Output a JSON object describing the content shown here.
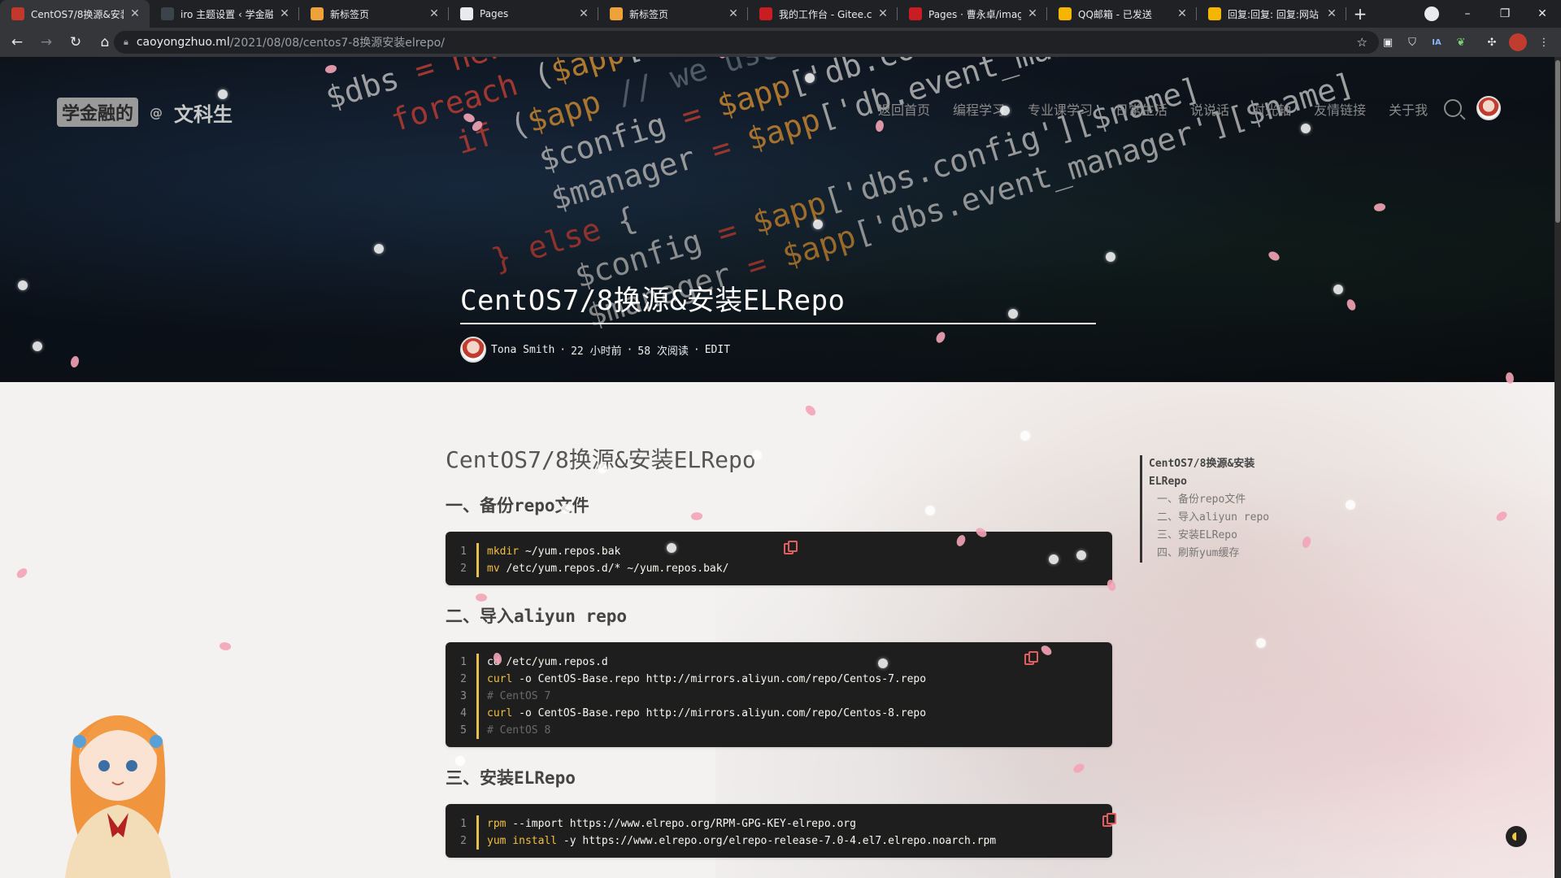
{
  "browser": {
    "tabs": [
      {
        "title": "CentOS7/8换源&安装",
        "icon_color": "#c0392b",
        "icon": "blog-favicon",
        "active": true
      },
      {
        "title": "iro 主题设置 ‹ 学金融",
        "icon_color": "#3c434a",
        "icon": "wordpress-icon"
      },
      {
        "title": "新标签页",
        "icon_color": "#f0a23a",
        "icon": "infinity-icon"
      },
      {
        "title": "Pages",
        "icon_color": "#e8eaed",
        "icon": "github-icon"
      },
      {
        "title": "新标签页",
        "icon_color": "#f0a23a",
        "icon": "infinity-icon"
      },
      {
        "title": "我的工作台 - Gitee.co",
        "icon_color": "#c71d23",
        "icon": "gitee-icon"
      },
      {
        "title": "Pages · 曹永卓/imag",
        "icon_color": "#c71d23",
        "icon": "gitee-icon"
      },
      {
        "title": "QQ邮箱 - 已发送",
        "icon_color": "#f5b500",
        "icon": "qqmail-icon"
      },
      {
        "title": "回复:回复: 回复:网站",
        "icon_color": "#f5b500",
        "icon": "qqmail-icon"
      }
    ],
    "new_tab": "+",
    "window_controls": [
      "–",
      "❐",
      "✕"
    ],
    "url_host": "caoyongzhuo.ml",
    "url_path": "/2021/08/08/centos7-8换源安装elrepo/",
    "ext_badge": "6"
  },
  "site": {
    "logo_box": "学金融的",
    "logo_at": "@",
    "logo_name": "文科生",
    "nav": [
      "返回首页",
      "编程学习",
      "专业课学习",
      "日常生活",
      "说说话",
      "时光轴",
      "友情链接",
      "关于我"
    ]
  },
  "post": {
    "hero_title": "CentOS7/8换源&安装ELRepo",
    "author": "Tona Smith",
    "time": "22 小时前",
    "reads": "58 次阅读",
    "edit": "EDIT",
    "title": "CentOS7/8换源&安装ELRepo",
    "sections": [
      {
        "heading": "一、备份repo文件"
      },
      {
        "heading": "二、导入aliyun repo"
      },
      {
        "heading": "三、安装ELRepo"
      }
    ],
    "code1": [
      {
        "n": "1",
        "kw": "mkdir",
        "rest": " ~/yum.repos.bak"
      },
      {
        "n": "2",
        "kw": "mv",
        "rest": " /etc/yum.repos.d/* ~/yum.repos.bak/"
      }
    ],
    "code2": [
      {
        "n": "1",
        "kw": "",
        "rest": "cd /etc/yum.repos.d"
      },
      {
        "n": "2",
        "kw": "curl",
        "rest": " -o CentOS-Base.repo http://mirrors.aliyun.com/repo/Centos-7.repo"
      },
      {
        "n": "3",
        "comment": "# CentOS 7"
      },
      {
        "n": "4",
        "kw": "curl",
        "rest": " -o CentOS-Base.repo http://mirrors.aliyun.com/repo/Centos-8.repo"
      },
      {
        "n": "5",
        "comment": "# CentOS 8"
      }
    ],
    "code3": [
      {
        "n": "1",
        "kw": "rpm",
        "rest": " --import https://www.elrepo.org/RPM-GPG-KEY-elrepo.org"
      },
      {
        "n": "2",
        "kw": "yum install",
        "rest": " -y https://www.elrepo.org/elrepo-release-7.0-4.el7.elrepo.noarch.rpm"
      }
    ]
  },
  "toc": {
    "items": [
      {
        "level": 0,
        "text": "CentOS7/8换源&安装ELRepo"
      },
      {
        "level": 1,
        "text": "一、备份repo文件"
      },
      {
        "level": 1,
        "text": "二、导入aliyun repo"
      },
      {
        "level": 1,
        "text": "三、安装ELRepo"
      },
      {
        "level": 1,
        "text": "四、刷新yum缓存"
      }
    ]
  },
  "colors": {
    "accent": "#e5c24b",
    "petal": "#f3a4b6",
    "code_bg": "#1e1e1e"
  }
}
